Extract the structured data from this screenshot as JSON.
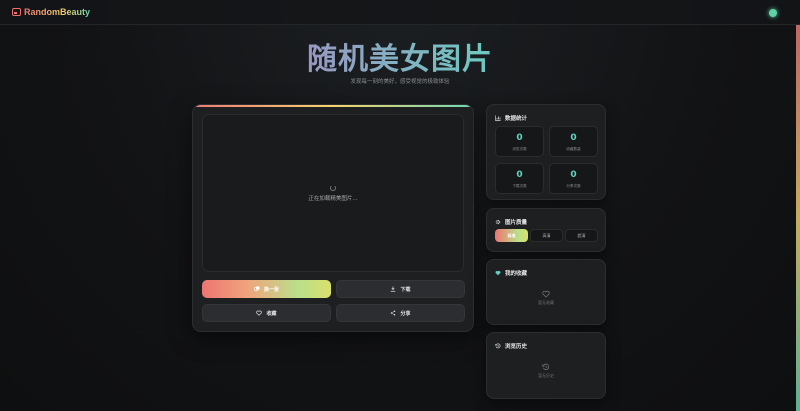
{
  "header": {
    "logo_text": "RandomBeauty",
    "logo_icon": "image-frame-icon",
    "status_color": "#5fd3a7"
  },
  "hero": {
    "title": "随机美女图片",
    "subtitle": "发现每一刻的美好，感受视觉的极致体验"
  },
  "viewer": {
    "loading_text": "正在加载精美图片...",
    "buttons": {
      "next_label": "换一张",
      "download_label": "下载",
      "favorite_label": "收藏",
      "share_label": "分享"
    }
  },
  "stats": {
    "title": "数据统计",
    "items": [
      {
        "value": "0",
        "label": "浏览次数"
      },
      {
        "value": "0",
        "label": "收藏数量"
      },
      {
        "value": "0",
        "label": "下载次数"
      },
      {
        "value": "0",
        "label": "分享次数"
      }
    ]
  },
  "quality": {
    "title": "图片质量",
    "options": [
      "标准",
      "高清",
      "超清"
    ],
    "selected": "标准"
  },
  "favorites": {
    "title": "我的收藏",
    "empty_text": "暂无收藏"
  },
  "history": {
    "title": "浏览历史",
    "empty_text": "暂无历史"
  },
  "colors": {
    "accent_gradient": [
      "#ee7472",
      "#b9e08a",
      "#dbe06b"
    ],
    "stat_number": "#5fd3c0"
  }
}
